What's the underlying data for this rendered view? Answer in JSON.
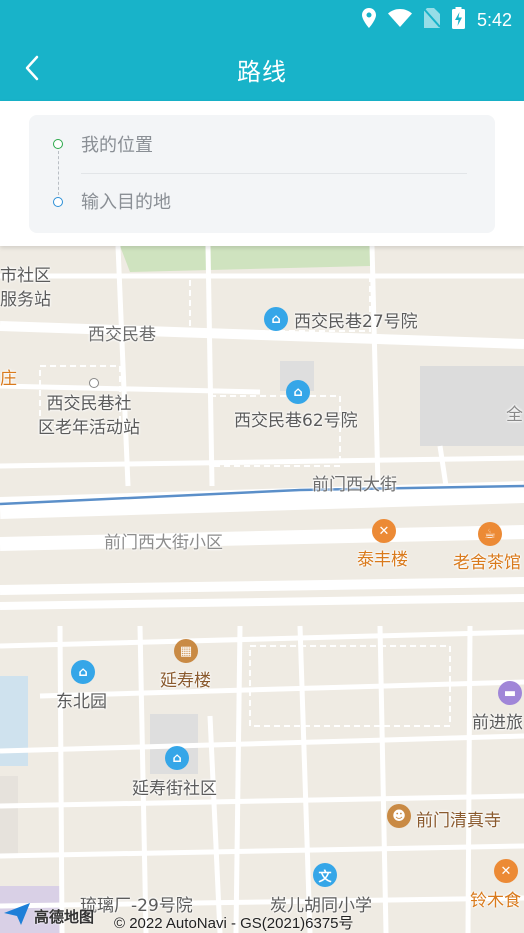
{
  "status_bar": {
    "time": "5:42"
  },
  "app_bar": {
    "title": "路线"
  },
  "route": {
    "from_placeholder": "我的位置",
    "to_placeholder": "输入目的地"
  },
  "map": {
    "labels": {
      "community_service": "市社区\n服务站",
      "xijiaominxiang_road": "西交民巷",
      "xijiao_27": "西交民巷27号院",
      "xijiao_62": "西交民巷62号院",
      "zhuang": "庄",
      "elderly_center": "西交民巷社\n区老年活动站",
      "quan": "全",
      "qianmen_west_street": "前门西大街",
      "qianmen_west_community": "前门西大街小区",
      "taifenglou": "泰丰楼",
      "laoshe_teahouse": "老舍茶馆",
      "yanshoulou": "延寿楼",
      "dongbeiyuan": "东北园",
      "qianjin": "前进旅",
      "yanshoujie_community": "延寿街社区",
      "qianmen_mosque": "前门清真寺",
      "liulichang_29": "琉璃厂-29号院",
      "tan_er_school": "炭儿胡同小学",
      "lingmu": "铃木食"
    },
    "logo_text": "高德地图",
    "copyright": "© 2022 AutoNavi - GS(2021)6375号"
  }
}
